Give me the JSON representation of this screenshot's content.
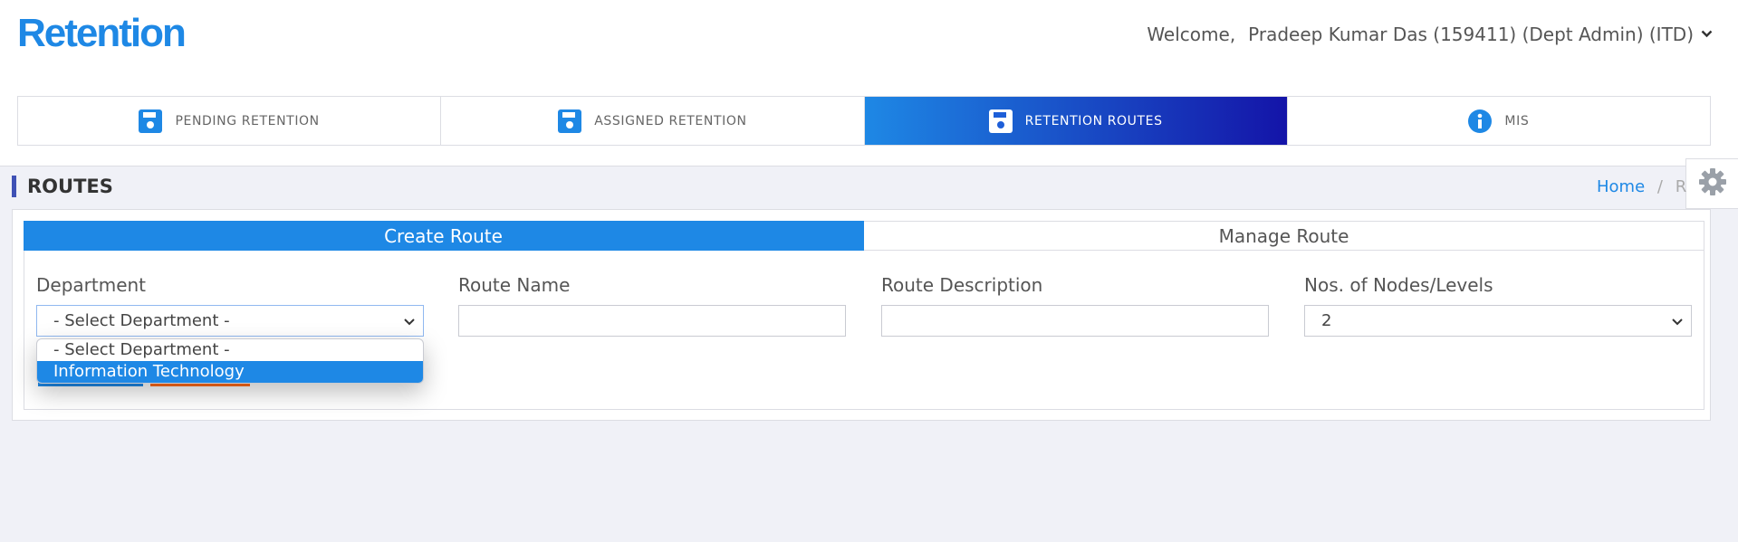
{
  "header": {
    "brand": "Retention",
    "welcome_label": "Welcome,",
    "user": "Pradeep Kumar Das (159411) (Dept Admin) (ITD)"
  },
  "nav_tabs": [
    {
      "label": "PENDING RETENTION",
      "icon": "floppy-disk-icon",
      "active": false
    },
    {
      "label": "ASSIGNED RETENTION",
      "icon": "floppy-disk-icon",
      "active": false
    },
    {
      "label": "RETENTION ROUTES",
      "icon": "floppy-disk-icon",
      "active": true
    },
    {
      "label": "MIS",
      "icon": "info-icon",
      "active": false
    }
  ],
  "page": {
    "title": "ROUTES",
    "breadcrumb_home": "Home",
    "breadcrumb_sep": "/",
    "breadcrumb_current": "R"
  },
  "subtabs": {
    "create": "Create Route",
    "manage": "Manage Route"
  },
  "form": {
    "department_label": "Department",
    "department_value": "- Select Department -",
    "route_name_label": "Route Name",
    "route_name_value": "",
    "route_desc_label": "Route Description",
    "route_desc_value": "",
    "nodes_label": "Nos. of Nodes/Levels",
    "nodes_value": "2"
  },
  "department_options": [
    {
      "label": "- Select Department -",
      "highlighted": false
    },
    {
      "label": "Information Technology",
      "highlighted": true
    }
  ],
  "colors": {
    "accent": "#1e88e5",
    "gradient_end": "#1414a8",
    "title_bar": "#3f51b5",
    "orange": "#ff6b1a",
    "background": "#f0f1f7"
  }
}
